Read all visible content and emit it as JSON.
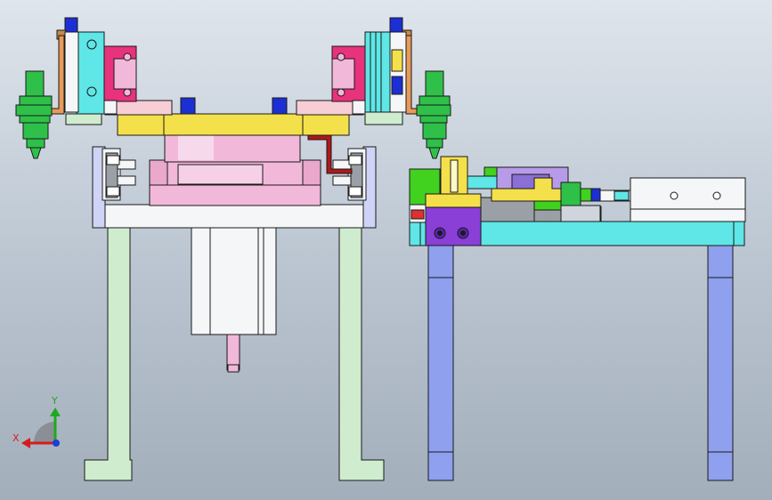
{
  "viewport": {
    "background_top": "#dfe5ec",
    "background_bottom": "#a3aebb"
  },
  "triad": {
    "x_label": "X",
    "y_label": "Y",
    "x_color": "#d41c1c",
    "y_color": "#1fa81f",
    "z_color": "#1c3fd4"
  },
  "palette": {
    "light_green": "#cfeccf",
    "yellow": "#f4e04a",
    "pink": "#f2b8d9",
    "magenta": "#e8327c",
    "cyan": "#5fe6e6",
    "dark_blue": "#1c2fd4",
    "periwinkle": "#8ea0ee",
    "purple": "#8a3fd6",
    "lavender": "#b89be8",
    "orange": "#e89a5a",
    "bright_green": "#41d11f",
    "dark_red": "#b01818",
    "white": "#f4f6f8",
    "gray": "#9aa0a6",
    "outline": "#1a1a1a"
  }
}
